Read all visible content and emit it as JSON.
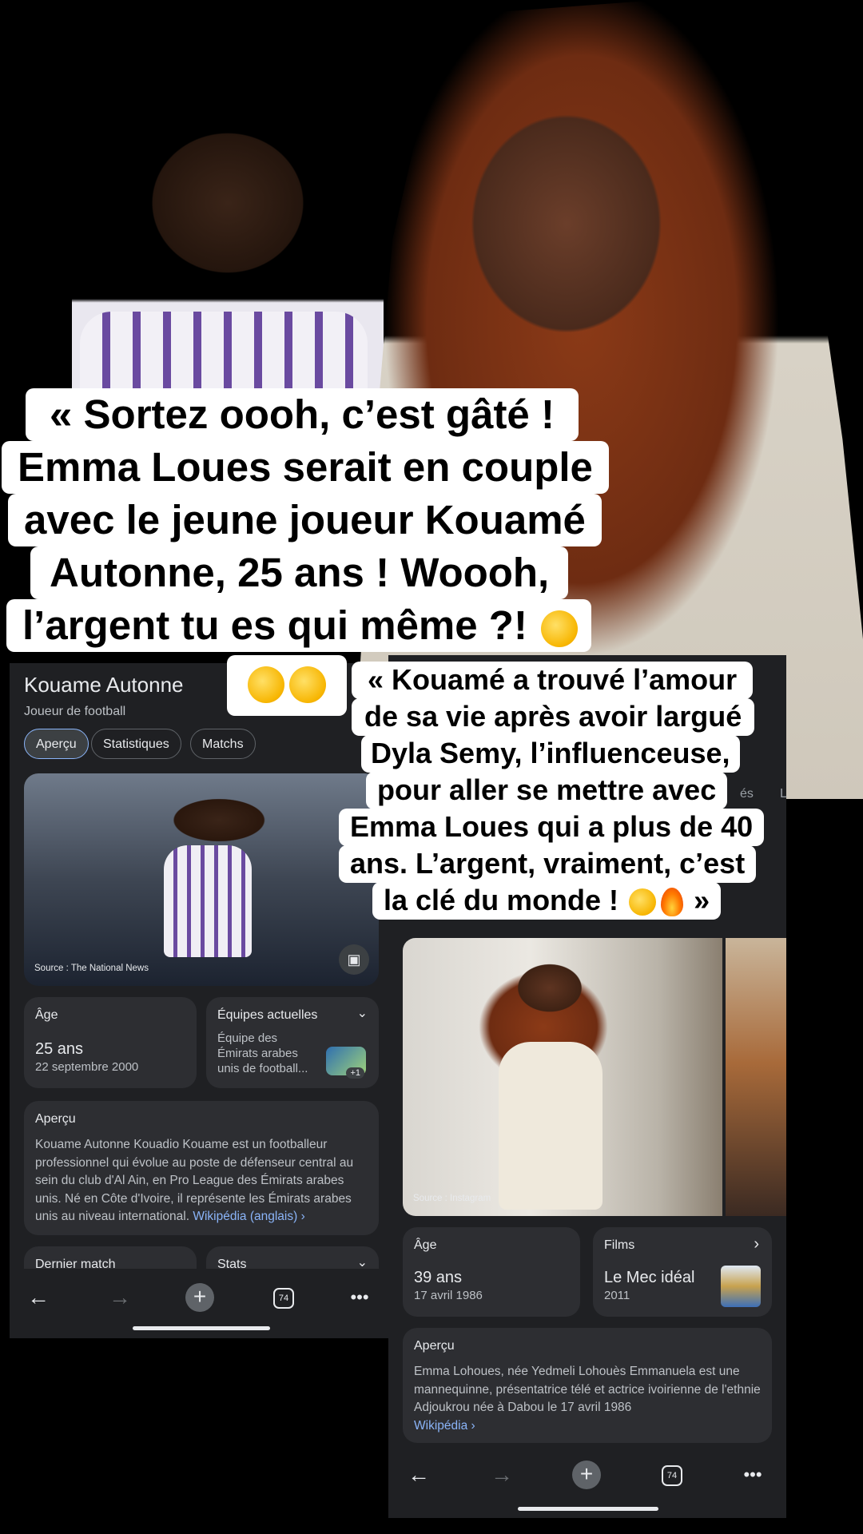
{
  "captions": {
    "top_lines": [
      "« Sortez oooh, c’est gâté !",
      "Emma Loues serait en couple",
      "avec le jeune joueur Kouamé",
      "Autonne, 25 ans ! Woooh,",
      "l’argent tu es qui même ?!"
    ],
    "second_lines": [
      "« Kouamé a trouvé l’amour",
      "de sa vie après avoir largué",
      "Dyla Semy, l’influenceuse,",
      "pour aller se mettre avec",
      "Emma Loues qui a plus de 40",
      "ans. L’argent, vraiment, c’est",
      "la clé du monde !",
      "»"
    ]
  },
  "left_panel": {
    "title": "Kouame Autonne",
    "subtitle": "Joueur de football",
    "tabs": [
      {
        "label": "Aperçu",
        "active": true
      },
      {
        "label": "Statistiques",
        "active": false
      },
      {
        "label": "Matchs",
        "active": false
      }
    ],
    "image_source": "Source : The National News",
    "image_icon": "image-gallery-icon",
    "age_card": {
      "label": "Âge",
      "value": "25 ans",
      "date": "22 septembre 2000"
    },
    "teams_card": {
      "label": "Équipes actuelles",
      "text": "Équipe des Émirats arabes unis de football...",
      "badge": "+1"
    },
    "overview": {
      "label": "Aperçu",
      "text": "Kouame Autonne Kouadio Kouame est un footballeur professionnel qui évolue au poste de défenseur central au sein du club d'Al Ain, en Pro League des Émirats arabes unis. Né en Côte d'Ivoire, il représente les Émirats arabes unis au niveau international.",
      "link": "Wikipédia (anglais) ›"
    },
    "partial_cards": [
      "Dernier match",
      "Stats"
    ],
    "toolbar": {
      "tabs_count": "74"
    }
  },
  "right_panel": {
    "partial_texts": [
      "és",
      "L"
    ],
    "image_source": "Source : Instagram",
    "age_card": {
      "label": "Âge",
      "value": "39 ans",
      "date": "17 avril 1986"
    },
    "films_card": {
      "label": "Films",
      "value": "Le Mec idéal",
      "year": "2011"
    },
    "overview": {
      "label": "Aperçu",
      "text": "Emma Lohoues, née Yedmeli Lohouès Emmanuela est une mannequinne, présentatrice télé et actrice ivoirienne de l'ethnie Adjoukrou née à Dabou le 17 avril 1986",
      "link": "Wikipédia ›"
    },
    "toolbar": {
      "tabs_count": "74"
    }
  },
  "colors": {
    "panel_bg": "#1f2023",
    "card_bg": "#2d2e32",
    "link": "#8ab4f8",
    "caption_bg": "#ffffff"
  }
}
